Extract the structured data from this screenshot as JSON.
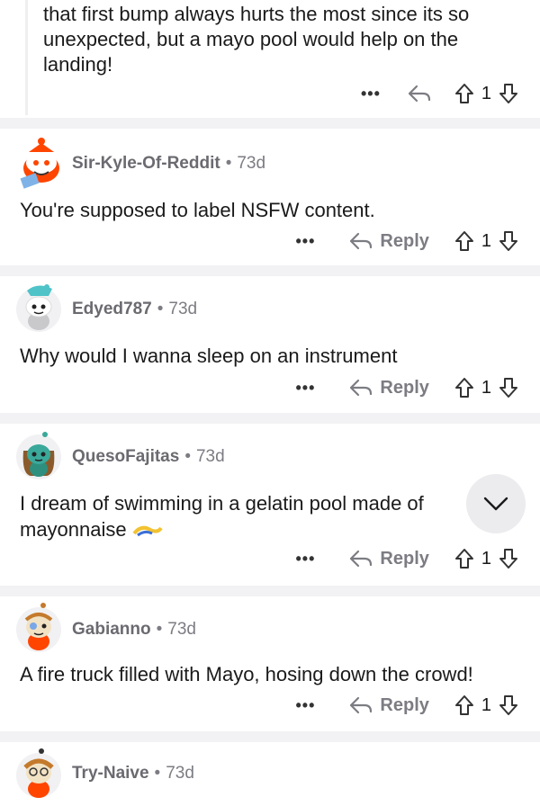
{
  "nested": {
    "text": "that first bump always hurts the most since its so unexpected, but a mayo pool would help on the landing!",
    "more": "•••",
    "votes": "1"
  },
  "comments": [
    {
      "user": "Sir-Kyle-Of-Reddit",
      "age": "73d",
      "text": "You're supposed to label NSFW content.",
      "reply": "Reply",
      "more": "•••",
      "votes": "1"
    },
    {
      "user": "Edyed787",
      "age": "73d",
      "text": "Why would I wanna sleep on an instrument",
      "reply": "Reply",
      "more": "•••",
      "votes": "1"
    },
    {
      "user": "QuesoFajitas",
      "age": "73d",
      "text": "I dream of swimming in a gelatin pool made of mayonnaise",
      "reply": "Reply",
      "more": "•••",
      "votes": "1"
    },
    {
      "user": "Gabianno",
      "age": "73d",
      "text": "A fire truck filled with Mayo, hosing down the crowd!",
      "reply": "Reply",
      "more": "•••",
      "votes": "1"
    },
    {
      "user": "Try-Naive",
      "age": "73d"
    }
  ],
  "dot": "•",
  "icons": {
    "reply": "reply-arrow-icon",
    "upvote": "upvote-arrow-icon",
    "downvote": "downvote-arrow-icon",
    "scroll": "chevron-down-icon"
  },
  "colors": {
    "muted": "#7c7c83",
    "separator": "#f2f2f4",
    "snoo_red": "#ff4500"
  }
}
